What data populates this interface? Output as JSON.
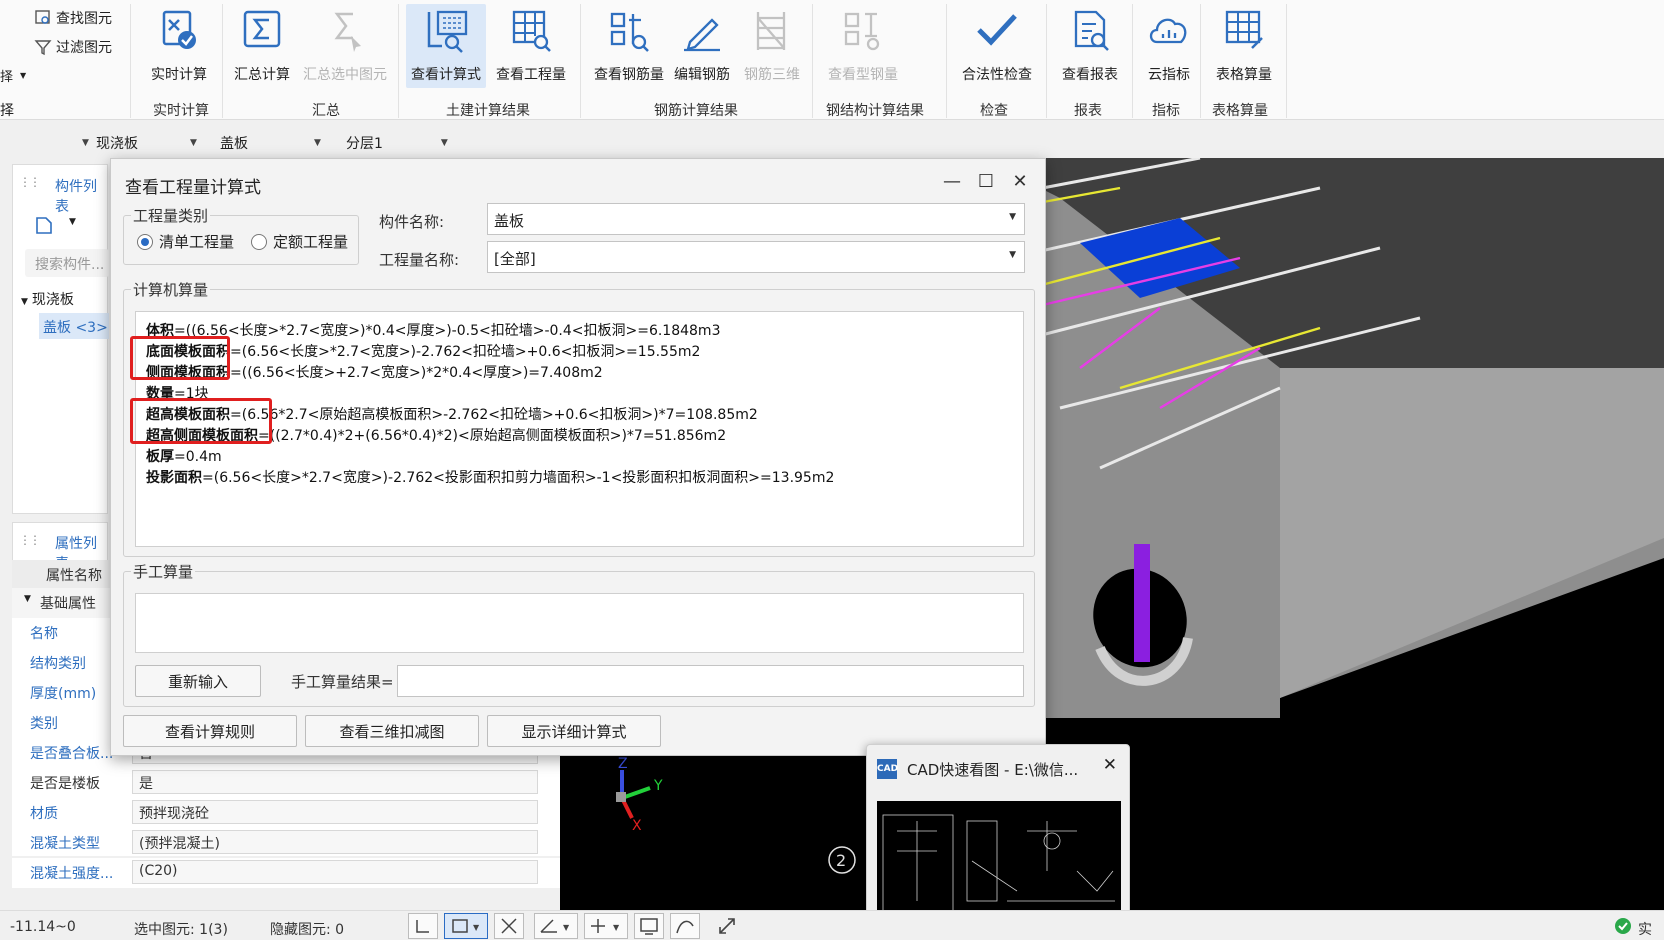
{
  "ribbon": {
    "small_commands": [
      "查找图元",
      "过滤图元"
    ],
    "cut_labels": [
      "择",
      "择"
    ],
    "buttons": [
      {
        "label": "实时计算",
        "icon": "realtime-calc-icon"
      },
      {
        "label": "汇总计算",
        "icon": "sum-calc-icon"
      },
      {
        "label": "汇总选中图元",
        "icon": "sum-selected-icon",
        "disabled": true
      },
      {
        "label": "查看计算式",
        "icon": "view-formula-icon",
        "active": true
      },
      {
        "label": "查看工程量",
        "icon": "view-quantity-icon"
      },
      {
        "label": "查看钢筋量",
        "icon": "view-rebar-icon"
      },
      {
        "label": "编辑钢筋",
        "icon": "edit-rebar-icon"
      },
      {
        "label": "钢筋三维",
        "icon": "rebar-3d-icon",
        "disabled": true
      },
      {
        "label": "查看型钢量",
        "icon": "view-steel-icon",
        "disabled": true
      },
      {
        "label": "合法性检查",
        "icon": "validity-check-icon"
      },
      {
        "label": "查看报表",
        "icon": "view-report-icon"
      },
      {
        "label": "云指标",
        "icon": "cloud-index-icon"
      },
      {
        "label": "表格算量",
        "icon": "table-calc-icon"
      }
    ],
    "groups": [
      "实时计算",
      "汇总",
      "土建计算结果",
      "钢筋计算结果",
      "钢结构计算结果",
      "检查",
      "报表",
      "指标",
      "表格算量"
    ]
  },
  "selectors": [
    "现浇板",
    "盖板",
    "分层1"
  ],
  "left_top": {
    "title": "构件列表",
    "search_placeholder": "搜索构件...",
    "tree_parent": "现浇板",
    "tree_child": "盖板 <3>"
  },
  "properties": {
    "title": "属性列表",
    "header": "属性名称",
    "group": "基础属性",
    "rows": [
      {
        "name": "名称",
        "value": ""
      },
      {
        "name": "结构类别",
        "value": ""
      },
      {
        "name": "厚度(mm)",
        "value": ""
      },
      {
        "name": "类别",
        "value": ""
      },
      {
        "name": "是否叠合板...",
        "value": "否"
      },
      {
        "name": "是否是楼板",
        "value": "是"
      },
      {
        "name": "材质",
        "value": "预拌现浇砼"
      },
      {
        "name": "混凝土类型",
        "value": "(预拌混凝土)"
      },
      {
        "name": "混凝土强度...",
        "value": "(C20)"
      }
    ]
  },
  "dialog": {
    "title": "查看工程量计算式",
    "qty_type_legend": "工程量类别",
    "radio_list": "清单工程量",
    "radio_quota": "定额工程量",
    "component_name_label": "构件名称:",
    "component_name_value": "盖板",
    "quantity_name_label": "工程量名称:",
    "quantity_name_value": "[全部]",
    "computer_legend": "计算机算量",
    "formulas": [
      {
        "name": "体积",
        "expr": "=((6.56<长度>*2.7<宽度>)*0.4<厚度>)-0.5<扣砼墙>-0.4<扣板洞>=6.1848m3"
      },
      {
        "name": "底面模板面积",
        "expr": "=(6.56<长度>*2.7<宽度>)-2.762<扣砼墙>+0.6<扣板洞>=15.55m2"
      },
      {
        "name": "侧面模板面积",
        "expr": "=((6.56<长度>+2.7<宽度>)*2*0.4<厚度>)=7.408m2"
      },
      {
        "name": "数量",
        "expr": "=1块"
      },
      {
        "name": "超高模板面积",
        "expr": "=(6.56*2.7<原始超高模板面积>-2.762<扣砼墙>+0.6<扣板洞>)*7=108.85m2"
      },
      {
        "name": "超高侧面模板面积",
        "expr": "=((2.7*0.4)*2+(6.56*0.4)*2)<原始超高侧面模板面积>)*7=51.856m2"
      },
      {
        "name": "板厚",
        "expr": "=0.4m"
      },
      {
        "name": "投影面积",
        "expr": "=(6.56<长度>*2.7<宽度>)-2.762<投影面积扣剪力墙面积>-1<投影面积扣板洞面积>=13.95m2"
      }
    ],
    "manual_legend": "手工算量",
    "reenter_button": "重新输入",
    "manual_result_label": "手工算量结果=",
    "btn_rules": "查看计算规则",
    "btn_3d": "查看三维扣减图",
    "btn_detail": "显示详细计算式"
  },
  "cad_popup": {
    "logo": "CAD",
    "title": "CAD快速看图 - E:\\微信..."
  },
  "viewport": {
    "axis_y": "Y",
    "axis_z": "Z",
    "axis_x": "X",
    "grid_num": "2"
  },
  "status": {
    "coord": "-11.14~0",
    "selected": "选中图元: 1(3)",
    "hidden": "隐藏图元: 0",
    "right": "实"
  }
}
